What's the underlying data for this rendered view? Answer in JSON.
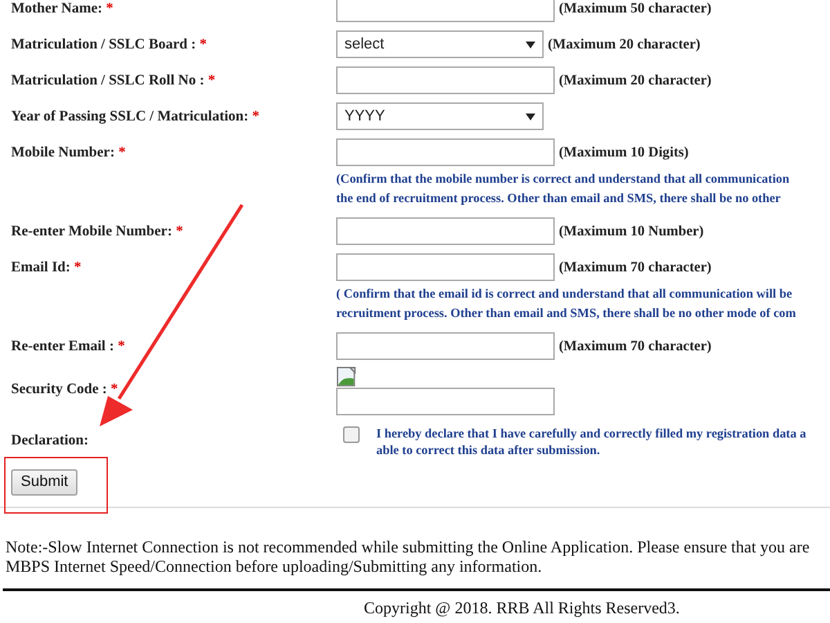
{
  "form": {
    "rows": [
      {
        "kind": "text",
        "label": "Mother Name:",
        "required_mark": "*",
        "hint": "(Maximum 50 character)"
      },
      {
        "kind": "select",
        "label": "Matriculation / SSLC Board :",
        "required_mark": "*",
        "value": "select",
        "hint": "(Maximum 20 character)"
      },
      {
        "kind": "text",
        "label": "Matriculation / SSLC Roll No :",
        "required_mark": "*",
        "hint": "(Maximum 20 character)"
      },
      {
        "kind": "select",
        "label": "Year of Passing SSLC / Matriculation:",
        "required_mark": "*",
        "value": "YYYY"
      },
      {
        "kind": "text",
        "label": "Mobile Number:",
        "required_mark": "*",
        "hint": "(Maximum 10 Digits)"
      },
      {
        "kind": "note",
        "lines": [
          "(Confirm that the mobile number is correct and understand that all communication",
          "the end of recruitment process. Other than email and SMS, there shall be no other"
        ]
      },
      {
        "kind": "text",
        "label": "Re-enter Mobile Number:",
        "required_mark": "*",
        "hint": "(Maximum 10 Number)"
      },
      {
        "kind": "text",
        "label": "Email Id:",
        "required_mark": "*",
        "hint": "(Maximum 70 character)"
      },
      {
        "kind": "note",
        "lines": [
          "( Confirm that the email id is correct and understand that all communication will be",
          "recruitment process. Other than email and SMS, there shall be no other mode of com"
        ]
      },
      {
        "kind": "text",
        "label": "Re-enter Email :",
        "required_mark": "*",
        "hint": "(Maximum 70 character)"
      },
      {
        "kind": "captcha",
        "label": "Security Code :",
        "required_mark": "*"
      },
      {
        "kind": "declaration",
        "label": "Declaration:",
        "checked": false,
        "lines": [
          "I hereby declare that I have carefully and correctly filled my registration data a",
          "able to correct this data after submission."
        ]
      }
    ],
    "submit": "Submit"
  },
  "note": [
    "Note:-Slow Internet Connection is not recommended while submitting the Online Application. Please ensure that you are",
    "MBPS Internet Speed/Connection before uploading/Submitting any information."
  ],
  "footer": "Copyright @ 2018. RRB All Rights Reserved3.",
  "annotations": {
    "arrow": true,
    "highlight_box": true
  }
}
